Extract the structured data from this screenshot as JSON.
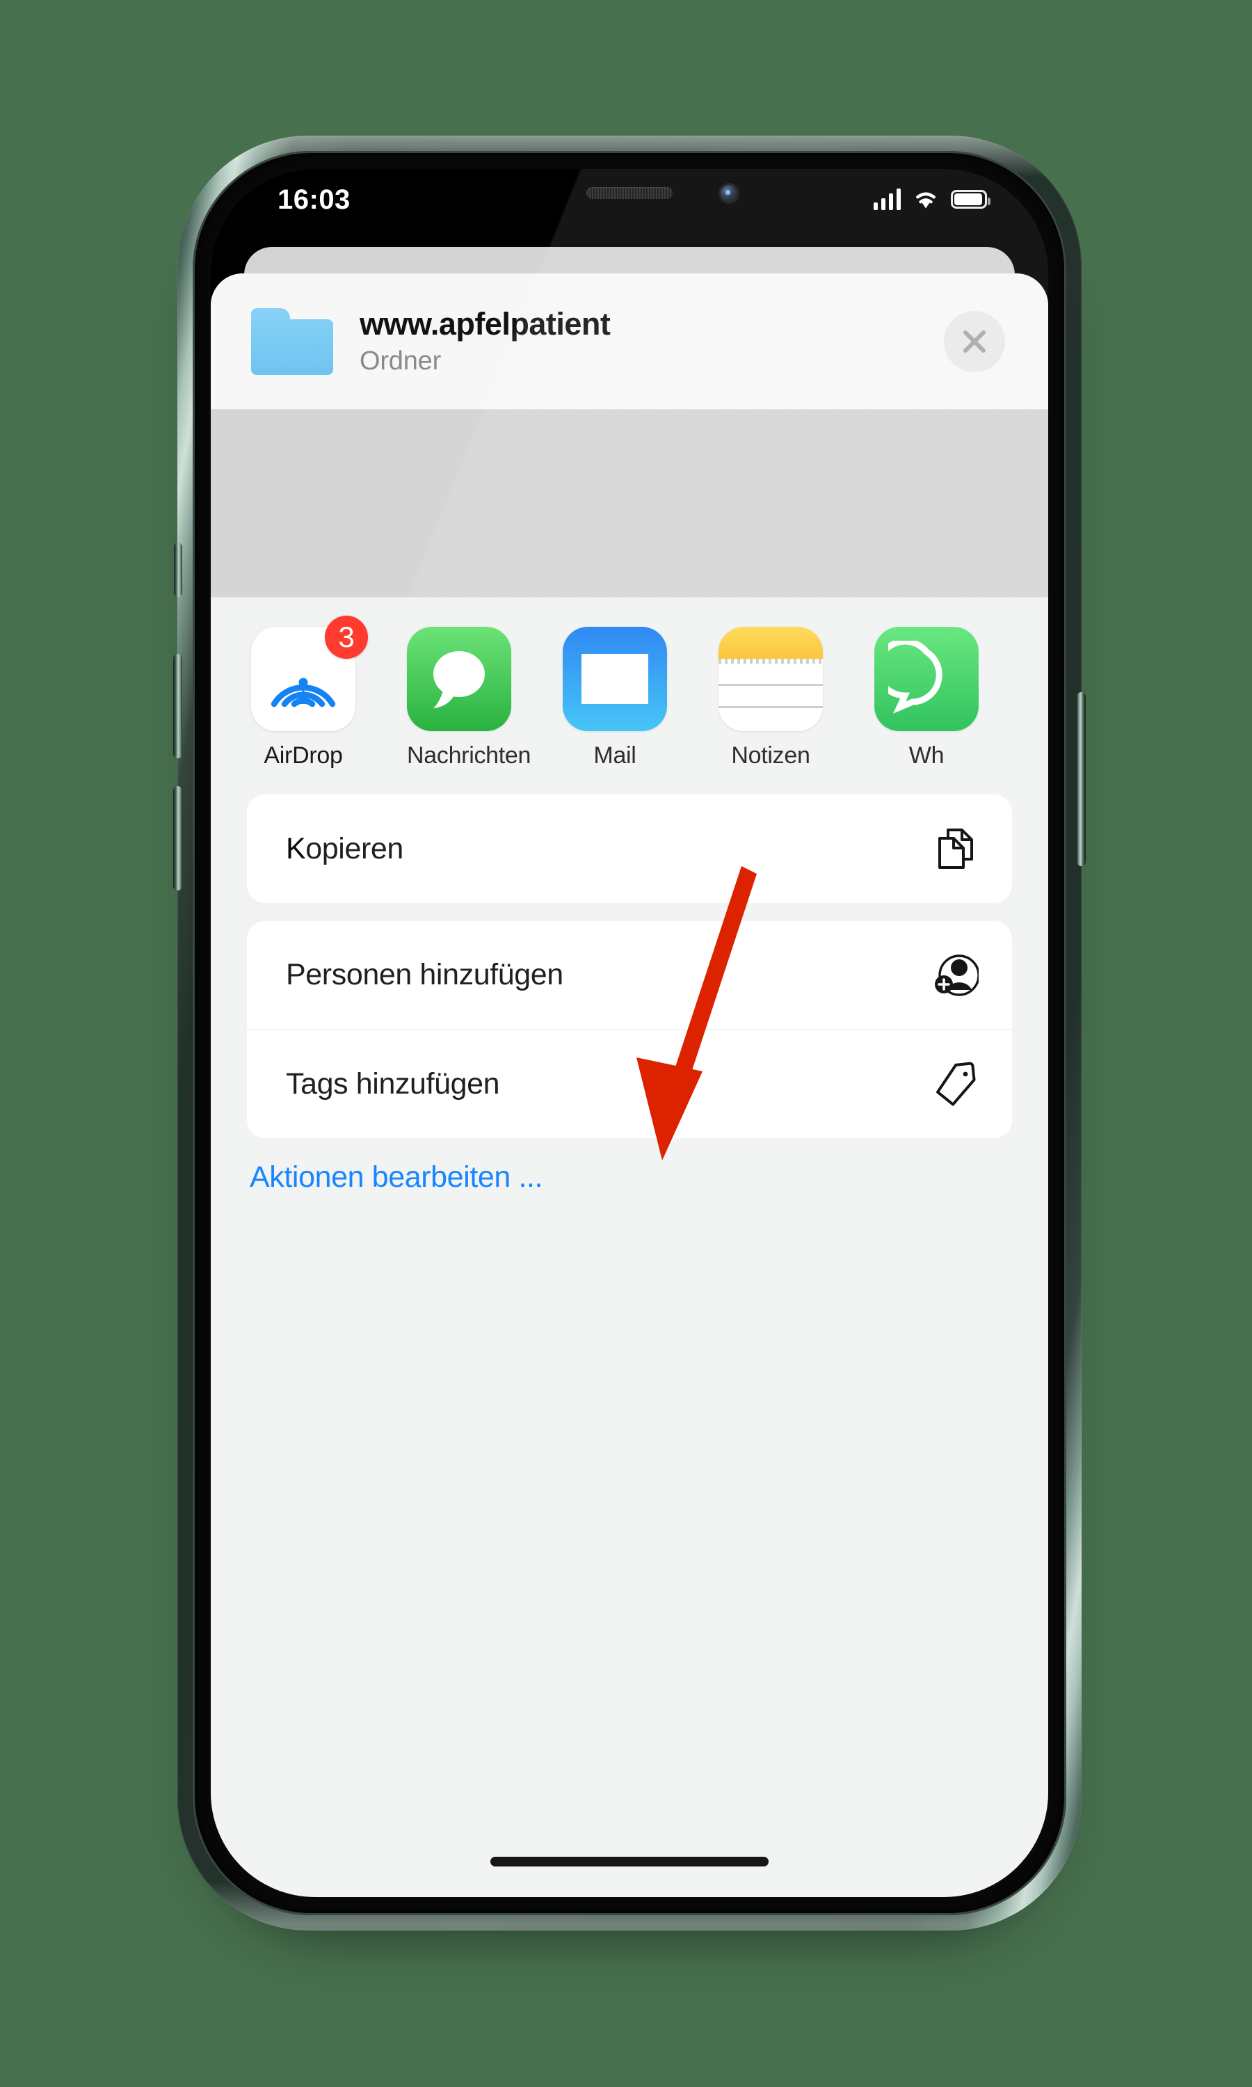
{
  "status_bar": {
    "time": "16:03",
    "signal_icon": "cellular-signal-icon",
    "wifi_icon": "wifi-icon",
    "battery_icon": "battery-icon"
  },
  "share_sheet": {
    "title": "www.apfelpatient",
    "subtitle": "Ordner",
    "item_icon": "folder-icon",
    "close_icon": "close-icon",
    "apps": [
      {
        "label": "AirDrop",
        "icon": "airdrop-icon",
        "badge": "3"
      },
      {
        "label": "Nachrichten",
        "icon": "messages-icon",
        "badge": ""
      },
      {
        "label": "Mail",
        "icon": "mail-icon",
        "badge": ""
      },
      {
        "label": "Notizen",
        "icon": "notes-icon",
        "badge": ""
      },
      {
        "label": "Wh",
        "icon": "whatsapp-icon",
        "badge": ""
      }
    ],
    "action_groups": [
      {
        "rows": [
          {
            "label": "Kopieren",
            "icon": "copy-icon"
          }
        ]
      },
      {
        "rows": [
          {
            "label": "Personen hinzufügen",
            "icon": "person-add-icon"
          },
          {
            "label": "Tags hinzufügen",
            "icon": "tag-icon"
          }
        ]
      }
    ],
    "edit_actions": "Aktionen bearbeiten ..."
  },
  "annotation": {
    "arrow_color": "#e02ب00",
    "points_to": "Personen hinzufügen"
  },
  "colors": {
    "background": "#47704e",
    "accent_blue": "#037aff",
    "badge_red": "#ff3b30",
    "folder_blue": "#7acdf5",
    "arrow_red": "#dd2200",
    "sheet_bg": "#f1f2f2"
  }
}
